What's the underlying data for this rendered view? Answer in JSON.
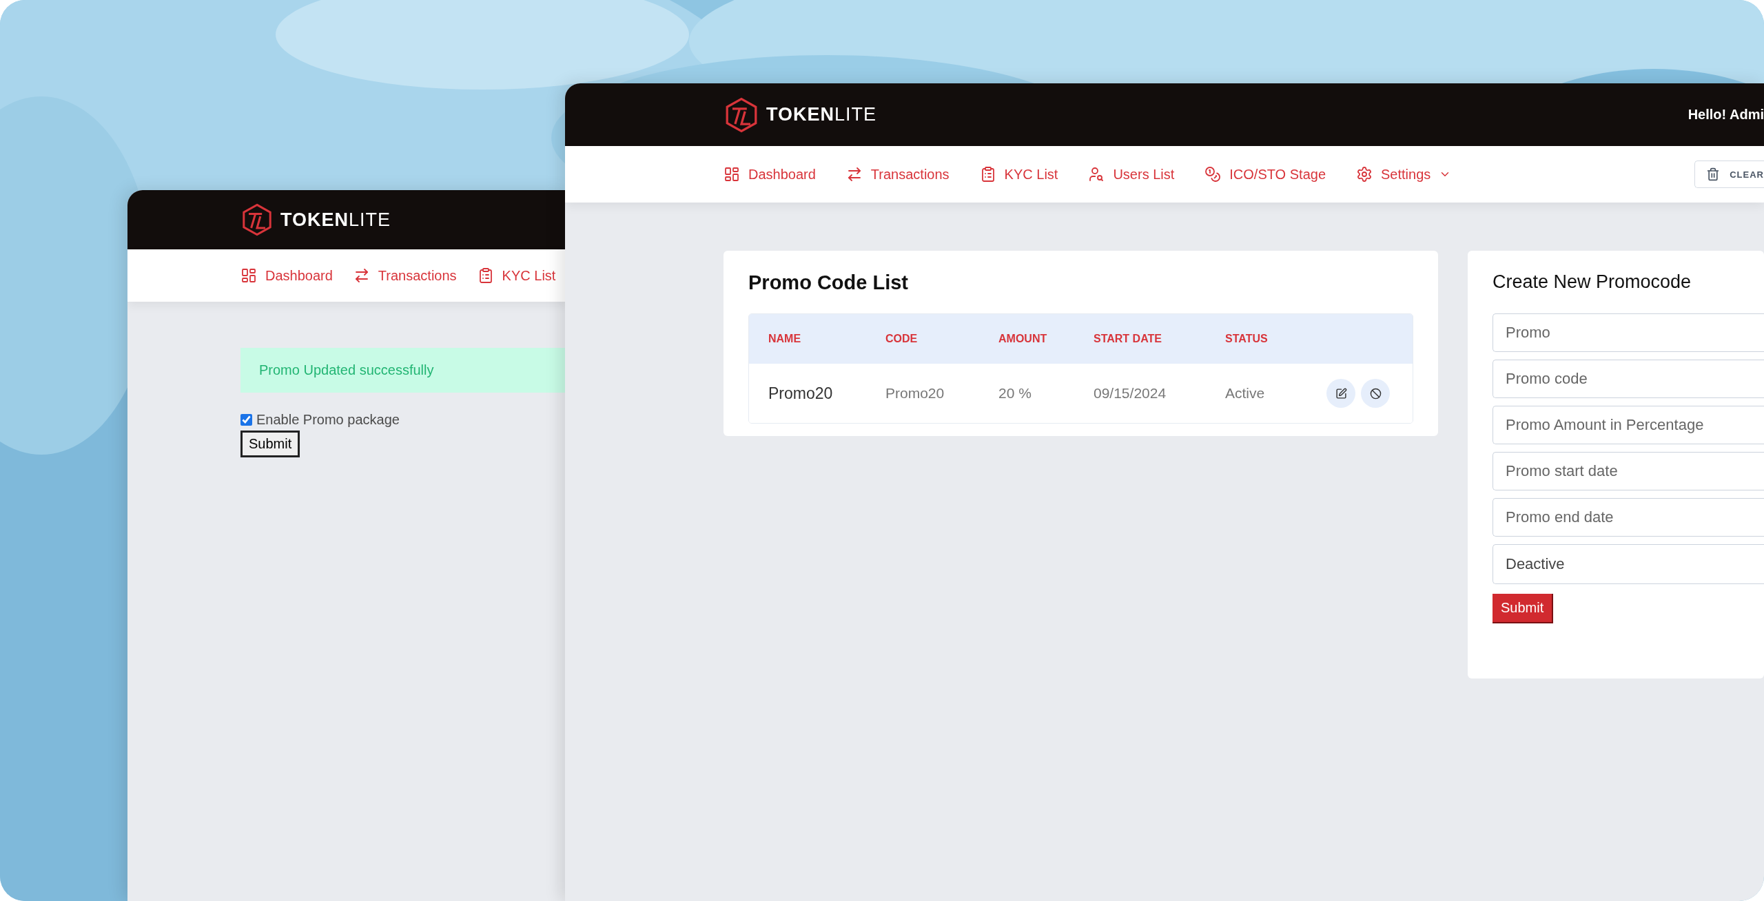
{
  "back_window": {
    "logo": "**TOKEN**LITE",
    "nav": [
      {
        "label": "Dashboard",
        "dropdown": false
      },
      {
        "label": "Transactions",
        "dropdown": false
      },
      {
        "label": "KYC List",
        "dropdown": false
      }
    ],
    "alert": "Promo Updated successfully",
    "checkbox": {
      "label": "Enable Promo package",
      "checked": true
    },
    "submit": "Submit"
  },
  "front_window": {
    "logo": "**TOKEN**LITE",
    "greeting": "Hello! Admi",
    "nav": [
      {
        "label": "Dashboard",
        "dropdown": false
      },
      {
        "label": "Transactions",
        "dropdown": false
      },
      {
        "label": "KYC List",
        "dropdown": false
      },
      {
        "label": "Users List",
        "dropdown": false
      },
      {
        "label": "ICO/STO Stage",
        "dropdown": false
      },
      {
        "label": "Settings",
        "dropdown": true
      }
    ],
    "clear_button": "CLEAR",
    "promo_list": {
      "title": "Promo Code List",
      "columns": [
        "NAME",
        "CODE",
        "AMOUNT",
        "START DATE",
        "STATUS"
      ],
      "rows": [
        {
          "name": "Promo20",
          "code": "Promo20",
          "amount": "20 %",
          "start_date": "09/15/2024",
          "status": "Active"
        }
      ]
    },
    "create_form": {
      "title": "Create New Promocode",
      "fields": [
        {
          "kind": "input",
          "placeholder": "Promo"
        },
        {
          "kind": "input",
          "placeholder": "Promo code"
        },
        {
          "kind": "input",
          "placeholder": "Promo Amount in Percentage"
        },
        {
          "kind": "input",
          "placeholder": "Promo start date"
        },
        {
          "kind": "input",
          "placeholder": "Promo end date"
        },
        {
          "kind": "select",
          "value": "Deactive"
        }
      ],
      "submit": "Submit"
    }
  }
}
